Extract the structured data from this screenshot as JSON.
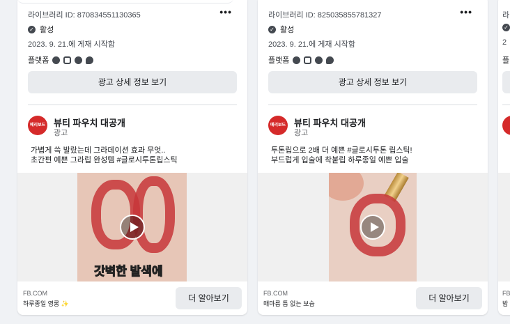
{
  "cards": [
    {
      "library_id": "라이브러리 ID: 870834551130365",
      "status": "활성",
      "date": "2023. 9. 21.에 게재 시작함",
      "platforms_label": "플랫폼",
      "detail_button": "광고 상세 정보 보기",
      "page_name": "뷰티 파우치 대공개",
      "sponsored": "광고",
      "avatar_text": "메리보드",
      "body_line1": "가볍게 쓱 발랐는데 그라데이션 효과 무엇..",
      "body_line2": "초간편 예쁜 그라립 완성템 #글로시투톤립스틱",
      "video_caption_red": "갓벽한 발색",
      "video_caption_white": "에",
      "cta_site": "FB.COM",
      "cta_desc": "하루종일 영롱 ✨",
      "cta_button": "더 알아보기"
    },
    {
      "library_id": "라이브러리 ID: 825035855781327",
      "status": "활성",
      "date": "2023. 9. 21.에 게재 시작함",
      "platforms_label": "플랫폼",
      "detail_button": "광고 상세 정보 보기",
      "page_name": "뷰티 파우치 대공개",
      "sponsored": "광고",
      "avatar_text": "메리보드",
      "body_line1": "투톤립으로 2배 더 예쁜 #글로시투톤 립스틱!",
      "body_line2": "부드럽게 입술에 착붙립 하루종일 예쁜 입술",
      "cta_site": "FB.COM",
      "cta_desc": "매마름 틈 없는 보습",
      "cta_button": "더 알아보기"
    },
    {
      "library_id": "라",
      "date": "2",
      "platforms_label": "플",
      "cta_site": "FB",
      "cta_desc": "밥"
    }
  ],
  "icons": [
    "more-icon",
    "check-circle-icon",
    "facebook-icon",
    "instagram-icon",
    "audience-network-icon",
    "messenger-icon",
    "play-icon"
  ],
  "colors": {
    "accent_red": "#d52a2a",
    "button_bg": "#e9ebee",
    "page_bg": "#f0f2f5"
  }
}
